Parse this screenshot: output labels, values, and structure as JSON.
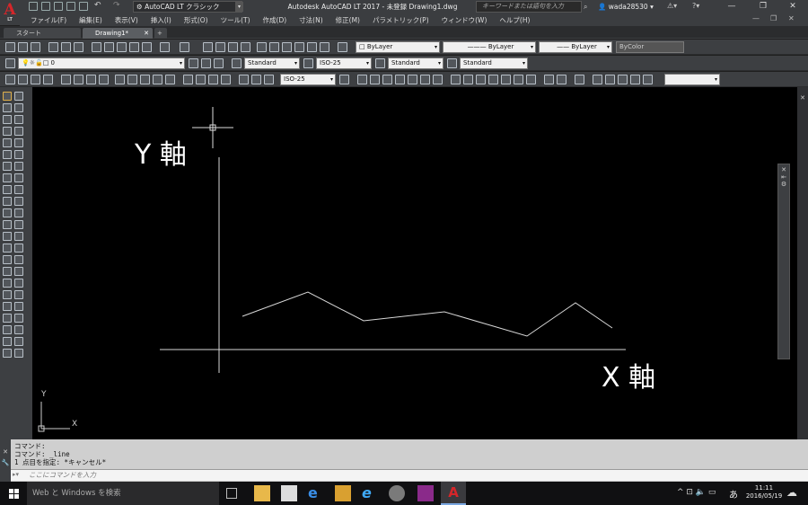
{
  "window": {
    "workspace": "AutoCAD LT クラシック",
    "title": "Autodesk AutoCAD LT 2017 - 未登録    Drawing1.dwg",
    "search_placeholder": "キーワードまたは語句を入力",
    "user": "wada28530",
    "app_logo": "A",
    "app_logo_sub": "LT"
  },
  "menu": [
    "ファイル(F)",
    "編集(E)",
    "表示(V)",
    "挿入(I)",
    "形式(O)",
    "ツール(T)",
    "作成(D)",
    "寸法(N)",
    "修正(M)",
    "パラメトリック(P)",
    "ウィンドウ(W)",
    "ヘルプ(H)"
  ],
  "tabs": [
    "スタート",
    "Drawing1*"
  ],
  "toolbar": {
    "color": "ByLayer",
    "linetype": "ByLayer",
    "lineweight": "ByLayer",
    "plotstyle": "ByColor",
    "layer": "0",
    "textstyle": "Standard",
    "dimstyle": "ISO-25",
    "tablestyle": "Standard",
    "mleaderstyle": "Standard",
    "dimstyle2": "ISO-25"
  },
  "canvas": {
    "y_label": "Y 軸",
    "x_label": "X 軸",
    "ucs_x": "X",
    "ucs_y": "Y"
  },
  "command": {
    "line1": "コマンド:",
    "line2": "コマンド: _line",
    "line3": "1 点目を指定: *キャンセル*",
    "placeholder": "ここにコマンドを入力"
  },
  "taskbar": {
    "search": "Web と Windows を検索",
    "time": "11:11",
    "date": "2016/05/19",
    "ime": "あ"
  },
  "colors": {
    "canvas": "#000000",
    "line": "#d8d8d8",
    "accent": "#d5262a"
  }
}
